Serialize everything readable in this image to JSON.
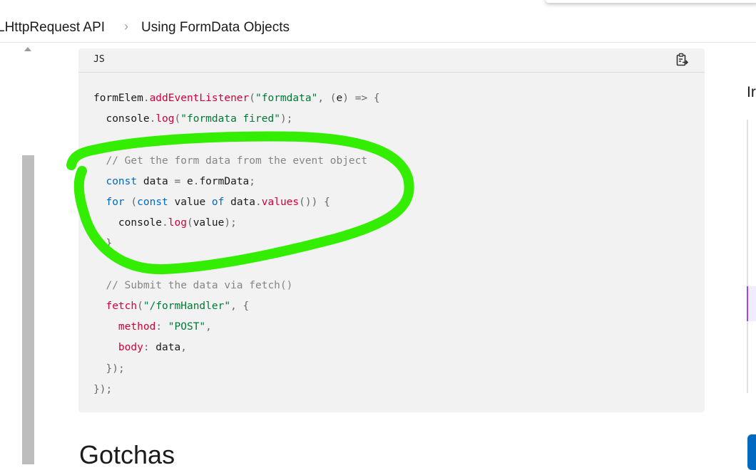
{
  "breadcrumb": {
    "items": [
      "LHttpRequest API",
      "Using FormData Objects"
    ],
    "separator": "›"
  },
  "code_block": {
    "language_label": "JS",
    "copy_icon": "clipboard-copy-icon",
    "lines": [
      "formElem.addEventListener(\"formdata\", (e) => {",
      "  console.log(\"formdata fired\");",
      "",
      "  // Get the form data from the event object",
      "  const data = e.formData;",
      "  for (const value of data.values()) {",
      "    console.log(value);",
      "  }",
      "",
      "  // Submit the data via fetch()",
      "  fetch(\"/formHandler\", {",
      "    method: \"POST\",",
      "    body: data,",
      "  });",
      "});"
    ]
  },
  "section_heading": "Gotchas",
  "right_panel": {
    "cut_text": "Ir"
  },
  "colors": {
    "annotation": "#33ee00",
    "function": "#d30038",
    "string": "#007936",
    "keyword": "#0069c2",
    "comment": "#858585",
    "code_background": "#f2f2f2",
    "scrollbar": "#bdbdbd",
    "right_button": "#0069c2"
  }
}
